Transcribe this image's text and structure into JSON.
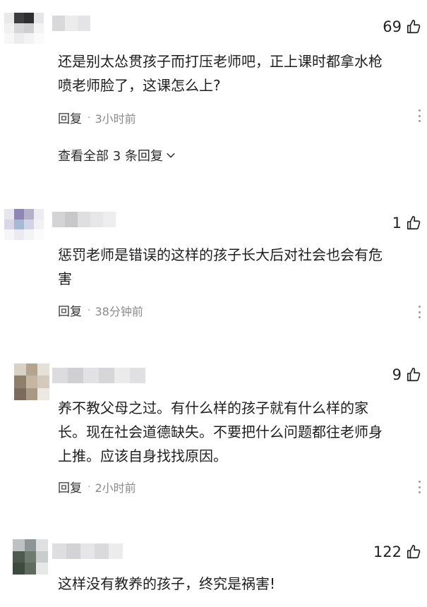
{
  "comments": [
    {
      "likes": "69",
      "text": "还是别太怂贯孩子而打压老师吧，正上课时都拿水枪\n喷老师脸了，这课怎么上?",
      "reply_label": "回复",
      "dot": "·",
      "time": "3小时前",
      "view_all": "查看全部 3 条回复"
    },
    {
      "likes": "1",
      "text": "惩罚老师是错误的这样的孩子长大后对社会也会有危\n害",
      "reply_label": "回复",
      "dot": "·",
      "time": "38分钟前"
    },
    {
      "likes": "9",
      "text": "养不教父母之过。有什么样的孩子就有什么样的家\n长。现在社会道德缺失。不要把什么问题都往老师身\n上推。应该自身找找原因。",
      "reply_label": "回复",
      "dot": "·",
      "time": "2小时前"
    },
    {
      "likes": "122",
      "text": "这样没有教养的孩子，终究是祸害!"
    }
  ],
  "icons": {
    "like": "thumbs-up-icon",
    "more": "more-vertical-icon",
    "chevron": "chevron-down-icon"
  },
  "colors": {
    "text": "#1e1e1e",
    "muted": "#8a8a8a",
    "background": "#ffffff"
  }
}
